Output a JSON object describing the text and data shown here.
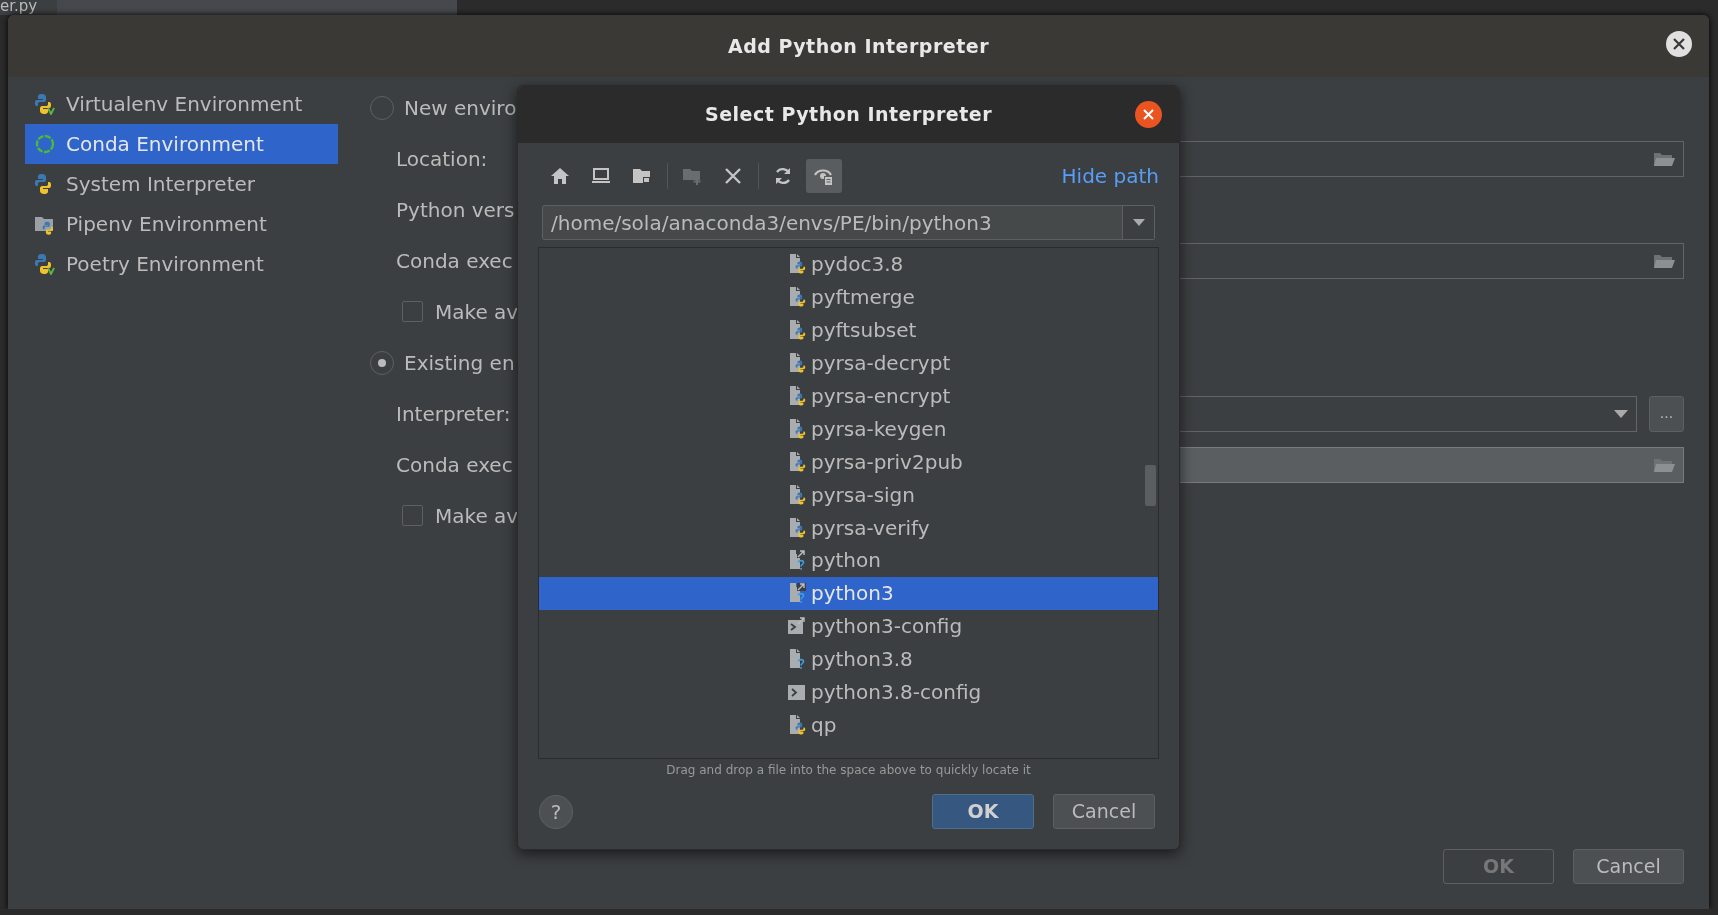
{
  "background": {
    "tab_text": "er.py"
  },
  "dialog": {
    "title": "Add Python Interpreter",
    "sidebar": [
      {
        "kind": "virtualenv",
        "label": "Virtualenv Environment",
        "selected": false
      },
      {
        "kind": "conda",
        "label": "Conda Environment",
        "selected": true
      },
      {
        "kind": "python",
        "label": "System Interpreter",
        "selected": false
      },
      {
        "kind": "pipenv",
        "label": "Pipenv Environment",
        "selected": false
      },
      {
        "kind": "poetry",
        "label": "Poetry Environment",
        "selected": false
      }
    ],
    "form": [
      {
        "kind": "radio",
        "label": "New enviro",
        "selected": false
      },
      {
        "kind": "path",
        "label": "Location:",
        "filled": false
      },
      {
        "kind": "label",
        "label": "Python vers"
      },
      {
        "kind": "path",
        "label": "Conda exec",
        "filled": false
      },
      {
        "kind": "checkbox",
        "label": "Make av",
        "checked": false
      },
      {
        "kind": "radio",
        "label": "Existing en",
        "selected": true
      },
      {
        "kind": "combo",
        "label": "Interpreter:",
        "more": "..."
      },
      {
        "kind": "path",
        "label": "Conda exec",
        "filled": true
      },
      {
        "kind": "checkbox",
        "label": "Make av",
        "checked": false
      }
    ],
    "buttons": [
      {
        "label": "OK",
        "disabled": true
      },
      {
        "label": "Cancel",
        "disabled": false
      }
    ]
  },
  "file_dialog": {
    "title": "Select Python Interpreter",
    "toolbar": [
      {
        "disabled": false,
        "pressed": false
      },
      {
        "disabled": false,
        "pressed": false
      },
      {
        "disabled": false,
        "pressed": false
      },
      {
        "disabled": true,
        "pressed": false
      },
      {
        "disabled": false,
        "pressed": false
      },
      {
        "disabled": false,
        "pressed": false
      },
      {
        "disabled": false,
        "pressed": true
      }
    ],
    "hide_path": "Hide path",
    "path": "/home/sola/anaconda3/envs/PE/bin/python3",
    "files": [
      {
        "kind": "python-script",
        "name": "pydoc3.8",
        "selected": false
      },
      {
        "kind": "python-script",
        "name": "pyftmerge",
        "selected": false
      },
      {
        "kind": "python-script",
        "name": "pyftsubset",
        "selected": false
      },
      {
        "kind": "python-script",
        "name": "pyrsa-decrypt",
        "selected": false
      },
      {
        "kind": "python-script",
        "name": "pyrsa-encrypt",
        "selected": false
      },
      {
        "kind": "python-script",
        "name": "pyrsa-keygen",
        "selected": false
      },
      {
        "kind": "python-script",
        "name": "pyrsa-priv2pub",
        "selected": false
      },
      {
        "kind": "python-script",
        "name": "pyrsa-sign",
        "selected": false
      },
      {
        "kind": "python-script",
        "name": "pyrsa-verify",
        "selected": false
      },
      {
        "kind": "link-unknown",
        "name": "python",
        "selected": false
      },
      {
        "kind": "link-unknown",
        "name": "python3",
        "selected": true
      },
      {
        "kind": "link-exec",
        "name": "python3-config",
        "selected": false
      },
      {
        "kind": "unknown",
        "name": "python3.8",
        "selected": false
      },
      {
        "kind": "exec",
        "name": "python3.8-config",
        "selected": false
      },
      {
        "kind": "python-script",
        "name": "qp",
        "selected": false
      }
    ],
    "hint": "Drag and drop a file into the space above to quickly locate it",
    "help": "?",
    "buttons": [
      {
        "label": "OK",
        "default": true
      },
      {
        "label": "Cancel",
        "default": false
      }
    ]
  }
}
